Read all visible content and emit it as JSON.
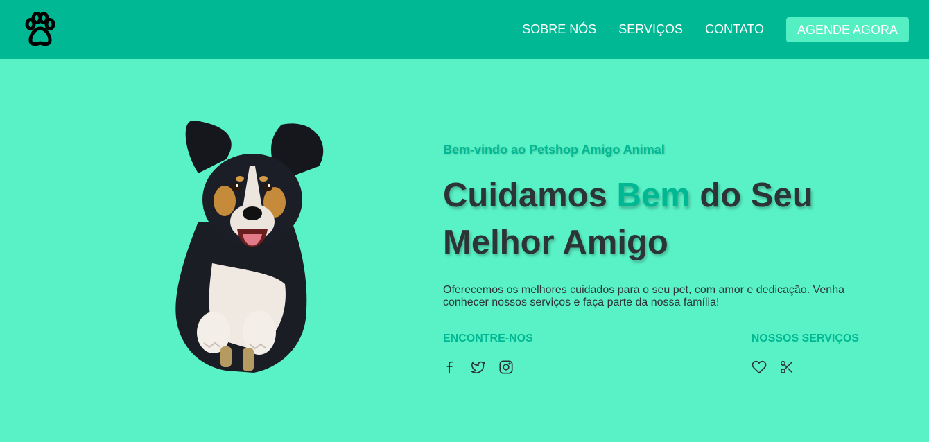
{
  "navbar": {
    "logo_icon": "paw-icon",
    "links": [
      "SOBRE NÓS",
      "SERVIÇOS",
      "CONTATO"
    ],
    "cta_label": "AGENDE AGORA"
  },
  "hero": {
    "image_alt": "Cachorro pulando",
    "subtitle": "Bem-vindo ao Petshop Amigo Animal",
    "headline_part1": "Cuidamos ",
    "headline_accent": "Bem",
    "headline_part2": " do Seu Melhor Amigo",
    "description": "Oferecemos os melhores cuidados para o seu pet, com amor e dedicação. Venha conhecer nossos serviços e faça parte da nossa família!",
    "find_us": {
      "title": "ENCONTRE-NOS",
      "icons": [
        "facebook-icon",
        "twitter-icon",
        "instagram-icon"
      ]
    },
    "services": {
      "title": "NOSSOS SERVIÇOS",
      "icons": [
        "heart-icon",
        "scissors-icon"
      ]
    }
  },
  "colors": {
    "navbar_bg": "#00b894",
    "page_bg": "#59f2c6",
    "accent": "#00b894",
    "cta_bg": "#55efc4",
    "text_dark": "#2d3436"
  }
}
